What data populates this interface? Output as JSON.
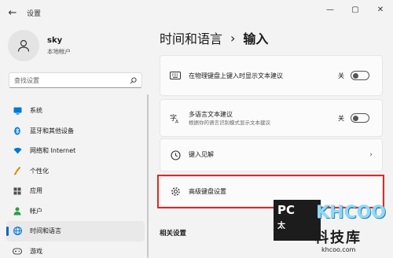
{
  "window": {
    "title": "设置",
    "controls": [
      "—",
      "▢",
      "✕"
    ]
  },
  "user": {
    "name": "sky",
    "account_type": "本地帐户"
  },
  "search": {
    "placeholder": "查找设置"
  },
  "sidebar": {
    "items": [
      {
        "label": "系统",
        "icon": "system-icon",
        "color": "#0078d4"
      },
      {
        "label": "蓝牙和其他设备",
        "icon": "bluetooth-icon",
        "color": "#0078d4"
      },
      {
        "label": "网络和 Internet",
        "icon": "wifi-icon",
        "color": "#0078d4"
      },
      {
        "label": "个性化",
        "icon": "brush-icon",
        "color": "#d18b00"
      },
      {
        "label": "应用",
        "icon": "apps-icon",
        "color": "#505050"
      },
      {
        "label": "帐户",
        "icon": "person-icon",
        "color": "#2c9f45"
      },
      {
        "label": "时间和语言",
        "icon": "globe-icon",
        "color": "#0078d4",
        "active": true
      },
      {
        "label": "游戏",
        "icon": "gamepad-icon",
        "color": "#505050"
      }
    ]
  },
  "breadcrumb": {
    "parent": "时间和语言",
    "separator": "›",
    "current": "输入"
  },
  "cards": [
    {
      "title": "在物理键盘上键入时显示文本建议",
      "subtitle": "",
      "state": "关",
      "control": "toggle",
      "icon": "keyboard-icon"
    },
    {
      "title": "多语言文本建议",
      "subtitle": "根据你的语言识别模式显示文本建议",
      "state": "关",
      "control": "toggle",
      "icon": "language-icon"
    },
    {
      "title": "键入见解",
      "subtitle": "",
      "state": "",
      "control": "chevron",
      "icon": "history-icon"
    },
    {
      "title": "高级键盘设置",
      "subtitle": "",
      "state": "",
      "control": "none",
      "icon": "gear-icon"
    }
  ],
  "section": {
    "related_title": "相关设置"
  },
  "watermark": {
    "pc_text": "PC",
    "pc_cn": "太",
    "brand": "KHCOO",
    "cn": "科技库",
    "url": "khcoo.com"
  }
}
